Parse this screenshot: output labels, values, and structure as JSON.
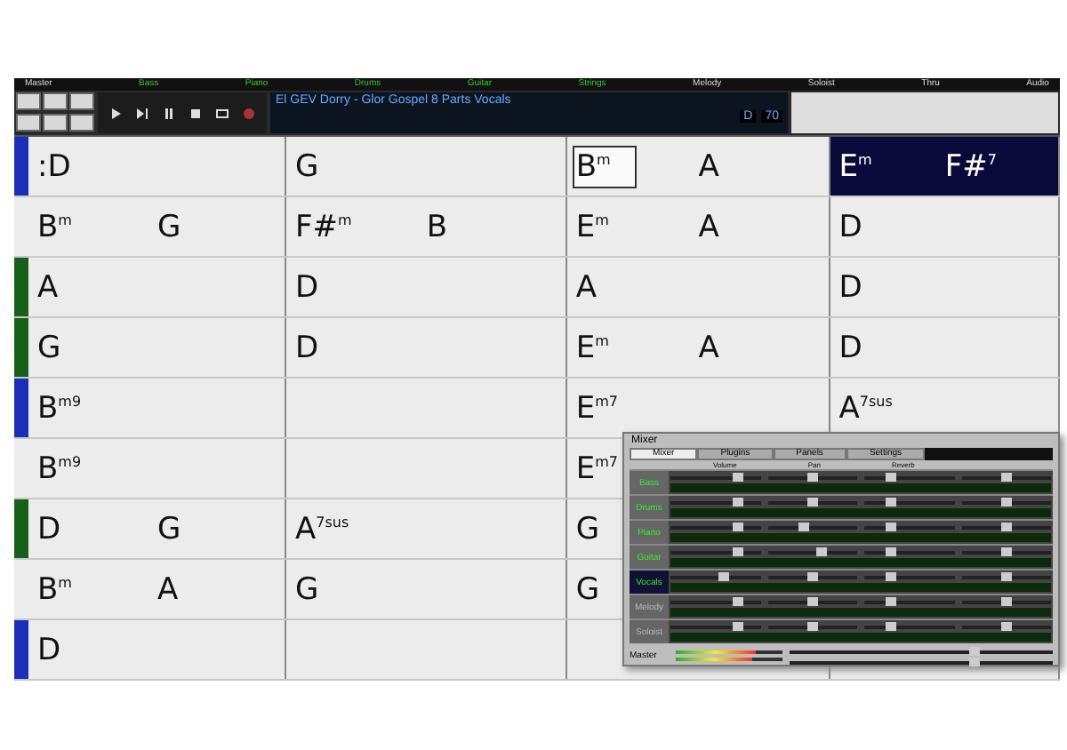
{
  "track_strip": [
    {
      "label": "Master",
      "active": false
    },
    {
      "label": "Bass",
      "active": true
    },
    {
      "label": "Piano",
      "active": true
    },
    {
      "label": "Drums",
      "active": true
    },
    {
      "label": "Guitar",
      "active": true
    },
    {
      "label": "Strings",
      "active": true
    },
    {
      "label": "Melody",
      "active": false
    },
    {
      "label": "Soloist",
      "active": false
    },
    {
      "label": "Thru",
      "active": false
    },
    {
      "label": "Audio",
      "active": false
    }
  ],
  "song": {
    "title": "El GEV Dorry - Glor Gospel 8 Parts Vocals",
    "key": "D",
    "tempo": "70"
  },
  "rows": [
    {
      "color": "#1a2fb8",
      "bars": [
        {
          "chords": [
            ":D"
          ],
          "selected": false,
          "focused": false
        },
        {
          "chords": [
            "G"
          ],
          "selected": false,
          "focused": false
        },
        {
          "chords": [
            "B$^{m}$",
            "A"
          ],
          "selected": false,
          "focused": true
        },
        {
          "chords": [
            "E$^{m}$",
            "F#$^{7}$"
          ],
          "selected": true,
          "focused": false
        }
      ]
    },
    {
      "bars": [
        {
          "chords": [
            "B$^{m}$",
            "G"
          ],
          "selected": false,
          "focused": false
        },
        {
          "chords": [
            "F#$^{m}$",
            "B"
          ],
          "selected": false,
          "focused": false
        },
        {
          "chords": [
            "E$^{m}$",
            "A"
          ],
          "selected": false,
          "focused": false
        },
        {
          "chords": [
            "D"
          ],
          "selected": false,
          "focused": false
        }
      ]
    },
    {
      "color": "#17601a",
      "bars": [
        {
          "chords": [
            "A"
          ],
          "selected": false,
          "focused": false
        },
        {
          "chords": [
            "D"
          ],
          "selected": false,
          "focused": false
        },
        {
          "chords": [
            "A"
          ],
          "selected": false,
          "focused": false
        },
        {
          "chords": [
            "D"
          ],
          "selected": false,
          "focused": false
        }
      ]
    },
    {
      "color": "#17601a",
      "bars": [
        {
          "chords": [
            "G"
          ],
          "selected": false,
          "focused": false
        },
        {
          "chords": [
            "D"
          ],
          "selected": false,
          "focused": false
        },
        {
          "chords": [
            "E$^{m}$",
            "A"
          ],
          "selected": false,
          "focused": false
        },
        {
          "chords": [
            "D"
          ],
          "selected": false,
          "focused": false
        }
      ]
    },
    {
      "color": "#1a2fb8",
      "bars": [
        {
          "chords": [
            "B$^{m9}$"
          ],
          "selected": false,
          "focused": false
        },
        {
          "selected": false
        },
        {
          "chords": [
            "E$^{m7}$"
          ],
          "selected": false,
          "focused": false
        },
        {
          "chords": [
            "A$^{7sus}$"
          ],
          "selected": false,
          "focused": false
        }
      ]
    },
    {
      "bars": [
        {
          "chords": [
            "B$^{m9}$"
          ],
          "selected": false,
          "focused": false
        },
        {
          "selected": false
        },
        {
          "chords": [
            "E$^{m7}$"
          ],
          "selected": false,
          "focused": false
        }
      ]
    },
    {
      "color": "#17601a",
      "bars": [
        {
          "chords": [
            "D",
            "G"
          ],
          "selected": false,
          "focused": false
        },
        {
          "chords": [
            "A$^{7sus}$"
          ],
          "selected": false,
          "focused": false
        },
        {
          "chords": [
            "G"
          ],
          "focused": false
        }
      ]
    },
    {
      "bars": [
        {
          "chords": [
            "B$^{m}$",
            "A"
          ],
          "selected": false,
          "focused": false
        },
        {
          "chords": [
            "G"
          ],
          "selected": false,
          "focused": false
        },
        {
          "chords": [
            "G"
          ],
          "focused": false
        }
      ]
    },
    {
      "color": "#1a2fb8",
      "bars": [
        {
          "chords": [
            "D"
          ],
          "selected": false,
          "focused": false
        },
        {
          "selected": false
        }
      ]
    }
  ],
  "mixer": {
    "title": "Mixer",
    "tabs": [
      {
        "label": "Mixer",
        "selected": true
      },
      {
        "label": "Plugins",
        "selected": false
      },
      {
        "label": "Panels",
        "selected": false
      },
      {
        "label": "Settings",
        "selected": false
      }
    ],
    "columns": [
      "Volume",
      "Pan",
      "Reverb"
    ],
    "tracks": [
      {
        "name": "Bass",
        "active": true,
        "selected": false,
        "sliders": [
          {
            "level": 0.75
          },
          {
            "level": 0.5
          },
          {
            "level": 0.3
          },
          {
            "level": 0.5
          }
        ]
      },
      {
        "name": "Drums",
        "active": true,
        "selected": false,
        "sliders": [
          {
            "level": 0.75
          },
          {
            "level": 0.5
          },
          {
            "level": 0.3
          },
          {
            "level": 0.5
          }
        ]
      },
      {
        "name": "Piano",
        "active": true,
        "selected": false,
        "sliders": [
          {
            "level": 0.75
          },
          {
            "level": 0.4
          },
          {
            "level": 0.3
          },
          {
            "level": 0.5
          }
        ]
      },
      {
        "name": "Guitar",
        "active": true,
        "selected": false,
        "sliders": [
          {
            "level": 0.75
          },
          {
            "level": 0.6
          },
          {
            "level": 0.3
          },
          {
            "level": 0.5
          }
        ]
      },
      {
        "name": "Vocals",
        "active": true,
        "selected": true,
        "sliders": [
          {
            "level": 0.6
          },
          {
            "level": 0.5
          },
          {
            "level": 0.3
          },
          {
            "level": 0.5
          }
        ]
      },
      {
        "name": "Melody",
        "active": false,
        "selected": false,
        "sliders": [
          {
            "level": 0.75
          },
          {
            "level": 0.5
          },
          {
            "level": 0.3
          },
          {
            "level": 0.5
          }
        ]
      },
      {
        "name": "Soloist",
        "active": false,
        "selected": false,
        "sliders": [
          {
            "level": 0.75
          },
          {
            "level": 0.5
          },
          {
            "level": 0.3
          },
          {
            "level": 0.5
          }
        ]
      }
    ],
    "master": {
      "label": "Master",
      "meters": [
        {
          "level": 0.75
        },
        {
          "level": 0.72
        }
      ],
      "sliders": [
        {
          "level": 0.7
        },
        {
          "level": 0.7
        }
      ]
    }
  }
}
